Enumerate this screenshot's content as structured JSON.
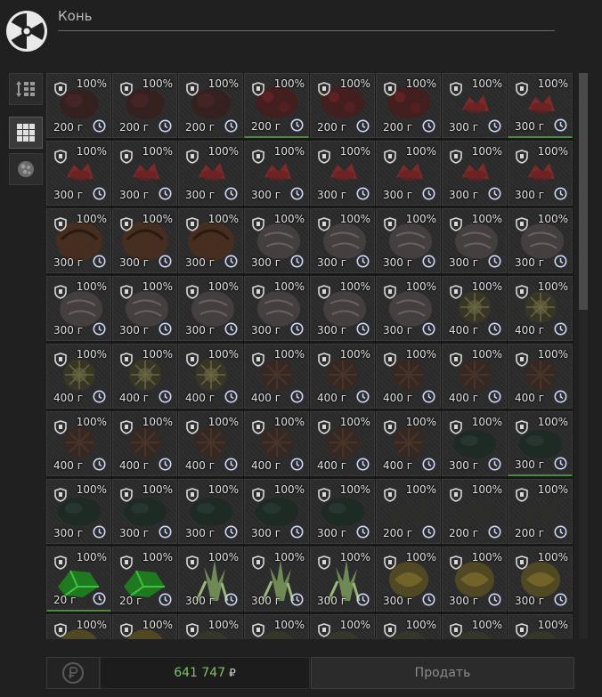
{
  "search": {
    "value": "Конь"
  },
  "sidebar": {
    "items": [
      {
        "icon": "sort-icon",
        "active": false
      },
      {
        "icon": "grid-view-icon",
        "active": true
      },
      {
        "icon": "artifact-category-icon",
        "active": false
      }
    ]
  },
  "grid": {
    "columns": 8,
    "item_icons": [
      "shield-icon",
      "clock-icon"
    ],
    "items": [
      {
        "pct": "100%",
        "weight": "200 г",
        "kind": "a"
      },
      {
        "pct": "100%",
        "weight": "200 г",
        "kind": "a"
      },
      {
        "pct": "100%",
        "weight": "200 г",
        "kind": "a"
      },
      {
        "pct": "100%",
        "weight": "200 г",
        "kind": "b",
        "found": true
      },
      {
        "pct": "100%",
        "weight": "200 г",
        "kind": "b"
      },
      {
        "pct": "100%",
        "weight": "200 г",
        "kind": "b"
      },
      {
        "pct": "100%",
        "weight": "300 г",
        "kind": "c"
      },
      {
        "pct": "100%",
        "weight": "300 г",
        "kind": "c",
        "found": true
      },
      {
        "pct": "100%",
        "weight": "300 г",
        "kind": "c"
      },
      {
        "pct": "100%",
        "weight": "300 г",
        "kind": "c"
      },
      {
        "pct": "100%",
        "weight": "300 г",
        "kind": "c"
      },
      {
        "pct": "100%",
        "weight": "300 г",
        "kind": "c"
      },
      {
        "pct": "100%",
        "weight": "300 г",
        "kind": "c"
      },
      {
        "pct": "100%",
        "weight": "300 г",
        "kind": "c"
      },
      {
        "pct": "100%",
        "weight": "300 г",
        "kind": "c"
      },
      {
        "pct": "100%",
        "weight": "300 г",
        "kind": "c"
      },
      {
        "pct": "100%",
        "weight": "300 г",
        "kind": "d"
      },
      {
        "pct": "100%",
        "weight": "300 г",
        "kind": "d"
      },
      {
        "pct": "100%",
        "weight": "300 г",
        "kind": "d"
      },
      {
        "pct": "100%",
        "weight": "300 г",
        "kind": "e"
      },
      {
        "pct": "100%",
        "weight": "300 г",
        "kind": "e"
      },
      {
        "pct": "100%",
        "weight": "300 г",
        "kind": "e"
      },
      {
        "pct": "100%",
        "weight": "300 г",
        "kind": "e"
      },
      {
        "pct": "100%",
        "weight": "300 г",
        "kind": "e"
      },
      {
        "pct": "100%",
        "weight": "300 г",
        "kind": "e"
      },
      {
        "pct": "100%",
        "weight": "300 г",
        "kind": "e"
      },
      {
        "pct": "100%",
        "weight": "300 г",
        "kind": "e"
      },
      {
        "pct": "100%",
        "weight": "300 г",
        "kind": "e"
      },
      {
        "pct": "100%",
        "weight": "300 г",
        "kind": "e"
      },
      {
        "pct": "100%",
        "weight": "300 г",
        "kind": "e"
      },
      {
        "pct": "100%",
        "weight": "400 г",
        "kind": "f"
      },
      {
        "pct": "100%",
        "weight": "400 г",
        "kind": "f"
      },
      {
        "pct": "100%",
        "weight": "400 г",
        "kind": "f"
      },
      {
        "pct": "100%",
        "weight": "400 г",
        "kind": "f"
      },
      {
        "pct": "100%",
        "weight": "400 г",
        "kind": "f"
      },
      {
        "pct": "100%",
        "weight": "400 г",
        "kind": "g"
      },
      {
        "pct": "100%",
        "weight": "400 г",
        "kind": "g"
      },
      {
        "pct": "100%",
        "weight": "400 г",
        "kind": "g"
      },
      {
        "pct": "100%",
        "weight": "400 г",
        "kind": "g"
      },
      {
        "pct": "100%",
        "weight": "400 г",
        "kind": "g"
      },
      {
        "pct": "100%",
        "weight": "400 г",
        "kind": "g"
      },
      {
        "pct": "100%",
        "weight": "400 г",
        "kind": "g"
      },
      {
        "pct": "100%",
        "weight": "400 г",
        "kind": "g"
      },
      {
        "pct": "100%",
        "weight": "400 г",
        "kind": "g"
      },
      {
        "pct": "100%",
        "weight": "400 г",
        "kind": "g"
      },
      {
        "pct": "100%",
        "weight": "400 г",
        "kind": "g"
      },
      {
        "pct": "100%",
        "weight": "300 г",
        "kind": "h"
      },
      {
        "pct": "100%",
        "weight": "300 г",
        "kind": "h",
        "found": true
      },
      {
        "pct": "100%",
        "weight": "300 г",
        "kind": "h"
      },
      {
        "pct": "100%",
        "weight": "300 г",
        "kind": "h"
      },
      {
        "pct": "100%",
        "weight": "300 г",
        "kind": "h"
      },
      {
        "pct": "100%",
        "weight": "300 г",
        "kind": "h"
      },
      {
        "pct": "100%",
        "weight": "300 г",
        "kind": "h"
      },
      {
        "pct": "100%",
        "weight": "200 г",
        "kind": "i"
      },
      {
        "pct": "100%",
        "weight": "200 г",
        "kind": "i"
      },
      {
        "pct": "100%",
        "weight": "200 г",
        "kind": "i"
      },
      {
        "pct": "100%",
        "weight": "20 г",
        "kind": "j",
        "found": true
      },
      {
        "pct": "100%",
        "weight": "20 г",
        "kind": "j"
      },
      {
        "pct": "100%",
        "weight": "300 г",
        "kind": "k"
      },
      {
        "pct": "100%",
        "weight": "300 г",
        "kind": "k"
      },
      {
        "pct": "100%",
        "weight": "300 г",
        "kind": "k"
      },
      {
        "pct": "100%",
        "weight": "300 г",
        "kind": "l"
      },
      {
        "pct": "100%",
        "weight": "300 г",
        "kind": "l"
      },
      {
        "pct": "100%",
        "weight": "300 г",
        "kind": "l"
      },
      {
        "pct": "100%",
        "weight": "",
        "kind": "l"
      },
      {
        "pct": "100%",
        "weight": "",
        "kind": "l"
      },
      {
        "pct": "100%",
        "weight": "",
        "kind": "m"
      },
      {
        "pct": "100%",
        "weight": "",
        "kind": "m"
      },
      {
        "pct": "100%",
        "weight": "",
        "kind": "m"
      },
      {
        "pct": "100%",
        "weight": "",
        "kind": "m"
      },
      {
        "pct": "100%",
        "weight": "",
        "kind": "m"
      },
      {
        "pct": "100%",
        "weight": "",
        "kind": "m"
      }
    ]
  },
  "scrollbar": {
    "position": 0
  },
  "footer": {
    "refresh_icon": "ruble-refresh-icon",
    "total_value": "641 747",
    "currency": "₽",
    "sell_label": "Продать"
  }
}
